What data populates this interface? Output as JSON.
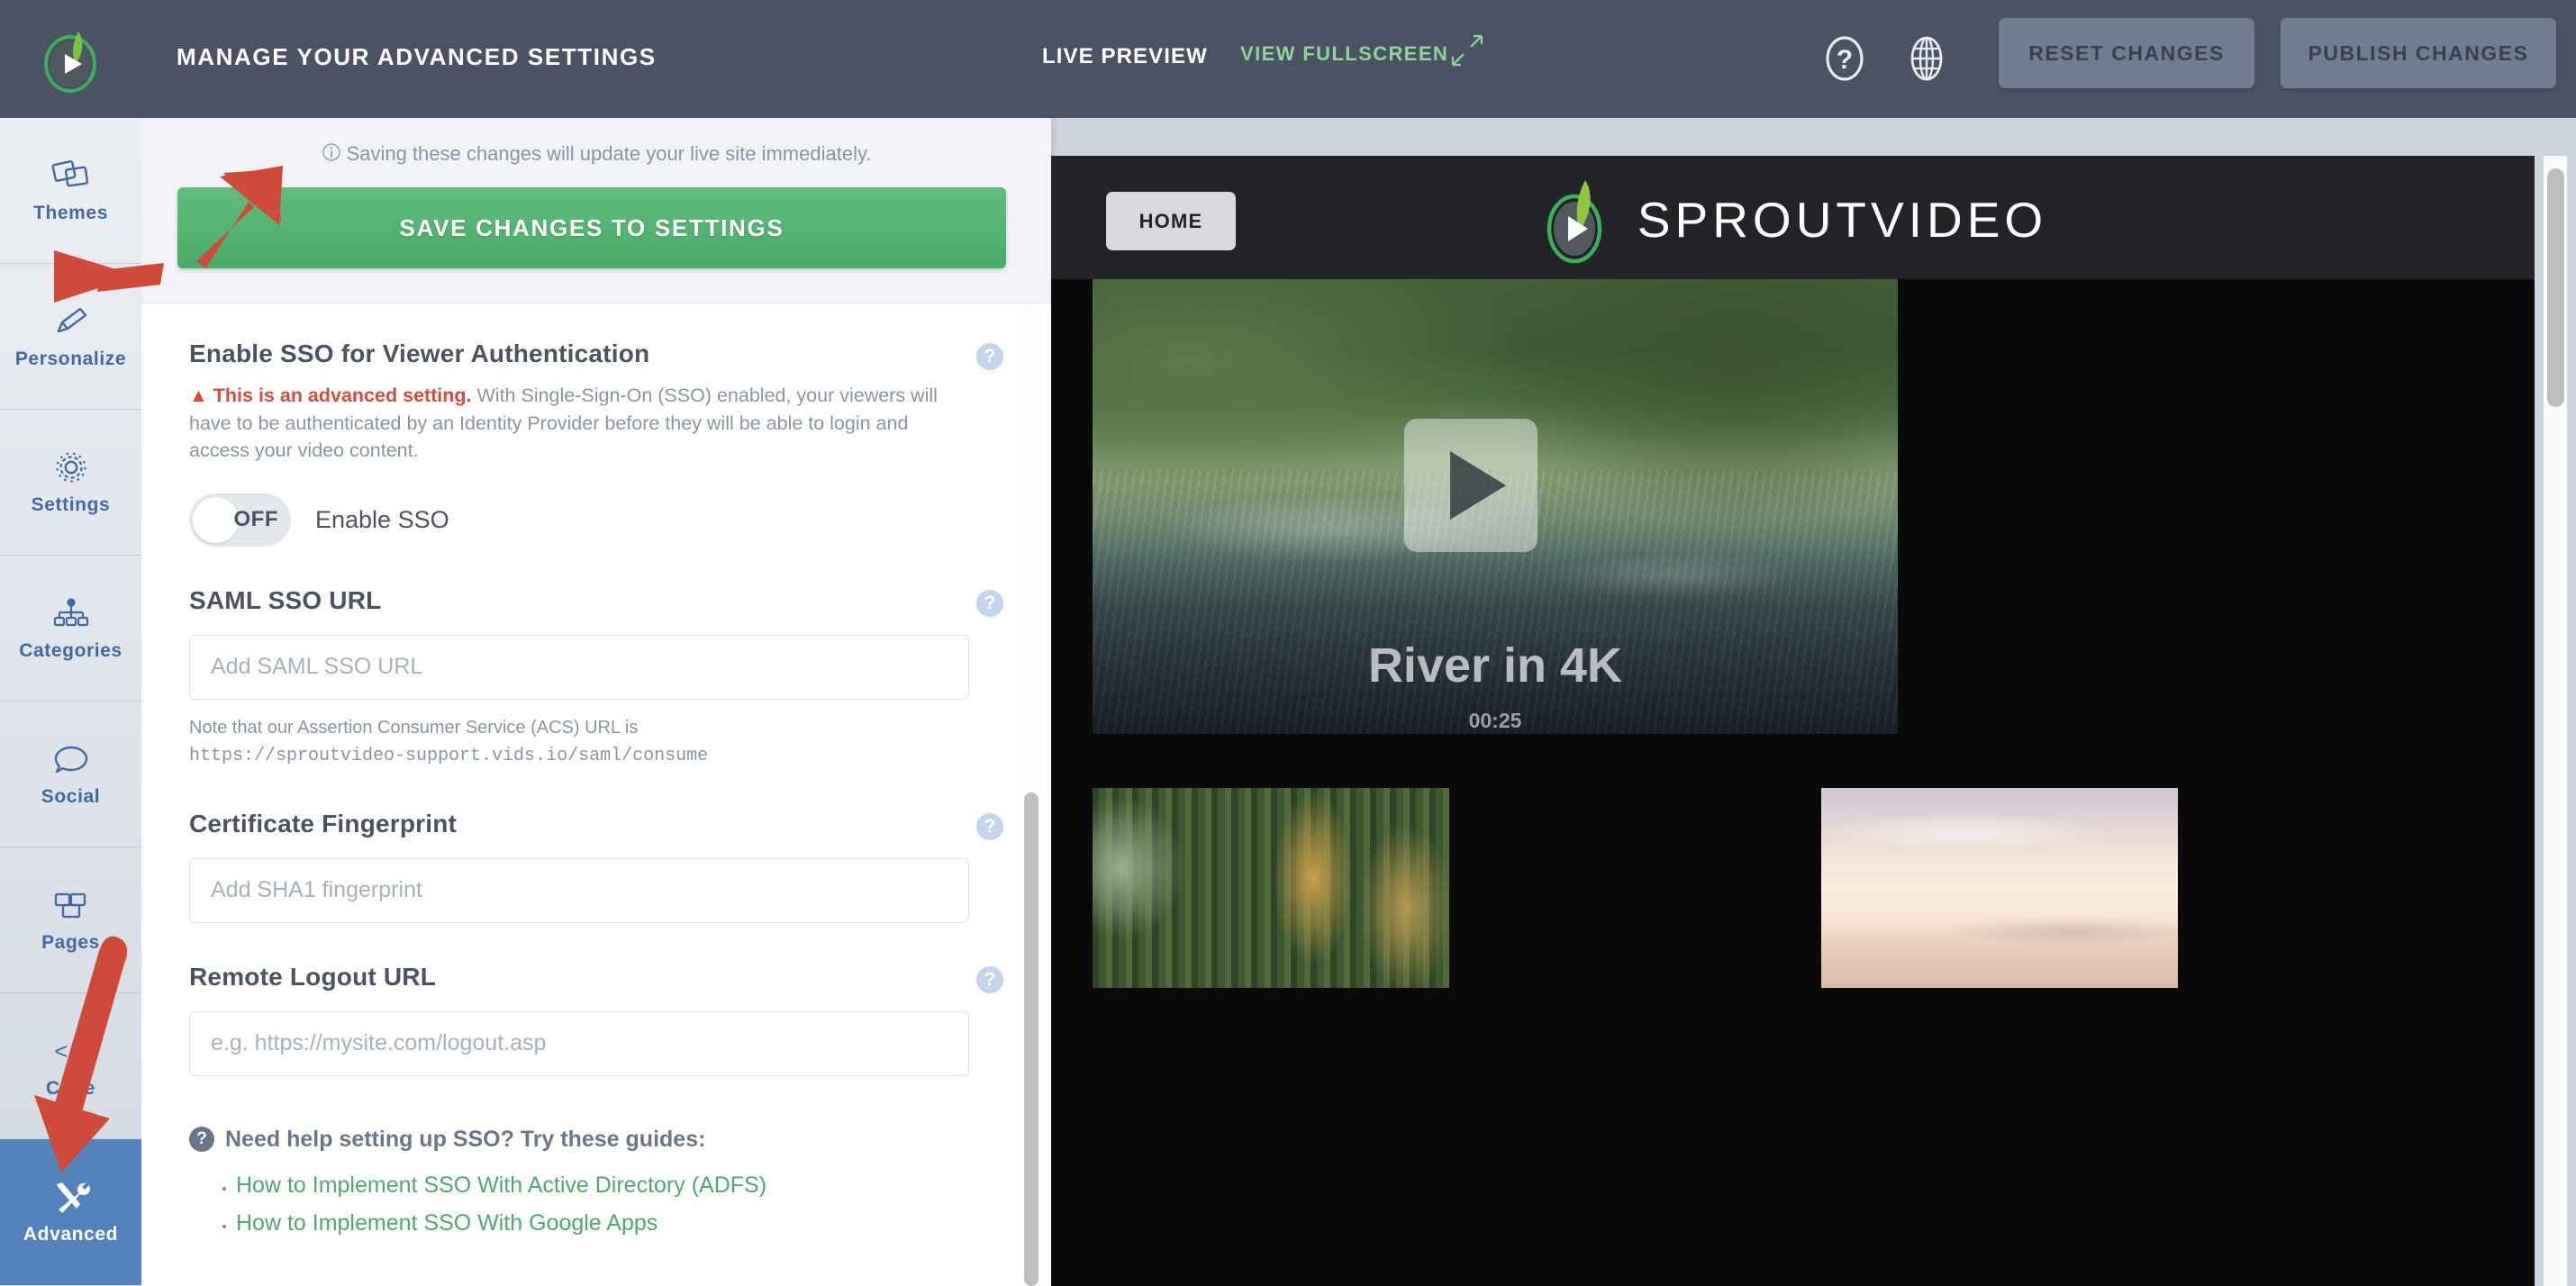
{
  "topbar": {
    "panel_title": "MANAGE YOUR ADVANCED SETTINGS",
    "live_preview_label": "LIVE PREVIEW",
    "view_fullscreen_label": "VIEW FULLSCREEN",
    "help_icon": "question-circle-icon",
    "globe_icon": "globe-icon",
    "reset_label": "RESET CHANGES",
    "publish_label": "PUBLISH CHANGES",
    "bar_color": "#4b5263",
    "button_color": "#727c91",
    "accent_green": "#8fd49a"
  },
  "sidebar": {
    "logo_icon": "sproutvideo-play-logo",
    "items": [
      {
        "label": "Themes",
        "icon": "layers-icon",
        "active": false
      },
      {
        "label": "Personalize",
        "icon": "pencil-icon",
        "active": false
      },
      {
        "label": "Settings",
        "icon": "gear-icon",
        "active": false
      },
      {
        "label": "Categories",
        "icon": "sitemap-icon",
        "active": false
      },
      {
        "label": "Social",
        "icon": "speech-bubble-icon",
        "active": false
      },
      {
        "label": "Pages",
        "icon": "pages-icon",
        "active": false
      },
      {
        "label": "Code",
        "icon": "code-brackets-icon",
        "active": false
      },
      {
        "label": "Advanced",
        "icon": "tools-icon",
        "active": true
      }
    ],
    "active_color": "#5482bd",
    "label_color": "#44699e"
  },
  "panel": {
    "save_note": "Saving these changes will update your live site immediately.",
    "save_note_icon": "info-circle-icon",
    "save_button_label": "SAVE CHANGES TO SETTINGS",
    "save_button_color": "#49ab68",
    "sso": {
      "heading": "Enable SSO for Viewer Authentication",
      "help_icon": "question-mark-icon",
      "warning_icon": "warning-triangle-icon",
      "warning_strong": "This is an advanced setting.",
      "warning_rest": " With Single-Sign-On (SSO) enabled, your viewers will have to be authenticated by an Identity Provider before they will be able to login and access your video content.",
      "toggle_state": "OFF",
      "toggle_caption": "Enable SSO"
    },
    "saml_sso_url": {
      "heading": "SAML SSO URL",
      "help_icon": "question-mark-icon",
      "value": "",
      "placeholder": "Add SAML SSO URL",
      "note_text": "Note that our Assertion Consumer Service (ACS) URL is",
      "note_url": "https://sproutvideo-support.vids.io/saml/consume"
    },
    "certificate_fingerprint": {
      "heading": "Certificate Fingerprint",
      "help_icon": "question-mark-icon",
      "value": "",
      "placeholder": "Add SHA1 fingerprint"
    },
    "remote_logout_url": {
      "heading": "Remote Logout URL",
      "help_icon": "question-mark-icon",
      "value": "",
      "placeholder": "e.g. https://mysite.com/logout.asp"
    },
    "help": {
      "icon": "question-circle-icon",
      "title": "Need help setting up SSO? Try these guides:",
      "links": [
        "How to Implement SSO With Active Directory (ADFS)",
        "How to Implement SSO With Google Apps"
      ],
      "link_color": "#4fa96c"
    }
  },
  "preview": {
    "home_button_label": "HOME",
    "site_logo_icon": "sproutvideo-play-logo",
    "site_logo_text": "SPROUTVIDEO",
    "hero": {
      "play_icon": "play-button-icon",
      "title": "River in 4K",
      "duration": "00:25"
    },
    "thumbnails": [
      {
        "name": "forest-thumbnail"
      },
      {
        "name": "sunset-sky-thumbnail"
      }
    ]
  },
  "annotations": {
    "arrow_color": "#cf4a3b",
    "arrows": [
      {
        "name": "arrow-to-save-button",
        "points_to": "SAVE CHANGES TO SETTINGS"
      },
      {
        "name": "arrow-to-sso-toggle",
        "points_to": "Enable SSO toggle"
      },
      {
        "name": "arrow-to-advanced-tab",
        "points_to": "Advanced sidebar item"
      }
    ]
  }
}
